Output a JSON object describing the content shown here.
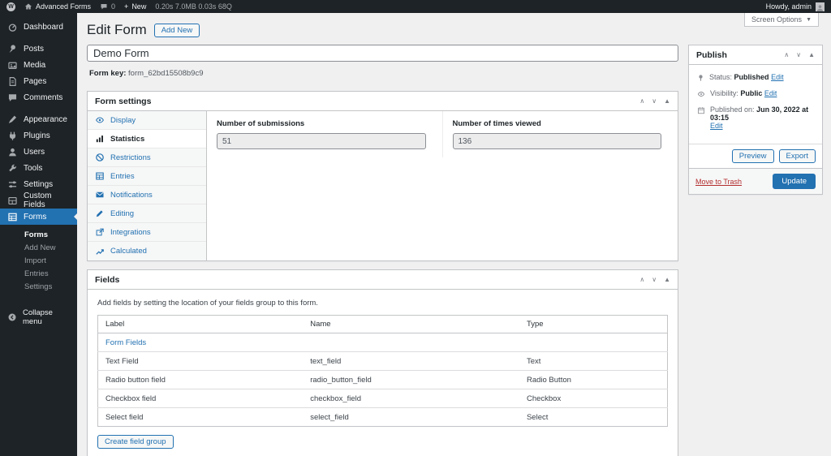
{
  "admin_bar": {
    "wp_logo_letter": "W",
    "site_name": "Advanced Forms",
    "comments_count": "0",
    "plus": "+",
    "new_label": "New",
    "perf_stats": "0.20s 7.0MB 0.03s 68Q",
    "howdy": "Howdy, admin"
  },
  "sidebar": {
    "items": [
      "Dashboard",
      "Posts",
      "Media",
      "Pages",
      "Comments",
      "Appearance",
      "Plugins",
      "Users",
      "Tools",
      "Settings",
      "Custom Fields",
      "Forms"
    ],
    "submenu": [
      "Forms",
      "Add New",
      "Import",
      "Entries",
      "Settings"
    ],
    "collapse_label": "Collapse menu"
  },
  "header": {
    "screen_options": "Screen Options",
    "title": "Edit Form",
    "add_new": "Add New"
  },
  "form": {
    "title_value": "Demo Form",
    "key_label": "Form key:",
    "key_value": "form_62bd15508b9c9"
  },
  "form_settings": {
    "title": "Form settings",
    "tabs": [
      "Display",
      "Statistics",
      "Restrictions",
      "Entries",
      "Notifications",
      "Editing",
      "Integrations",
      "Calculated"
    ],
    "active_tab": "Statistics",
    "fields": [
      {
        "label": "Number of submissions",
        "value": "51"
      },
      {
        "label": "Number of times viewed",
        "value": "136"
      }
    ]
  },
  "fields_box": {
    "title": "Fields",
    "description": "Add fields by setting the location of your fields group to this form.",
    "headers": [
      "Label",
      "Name",
      "Type"
    ],
    "group_label": "Form Fields",
    "rows": [
      [
        "Text Field",
        "text_field",
        "Text"
      ],
      [
        "Radio button field",
        "radio_button_field",
        "Radio Button"
      ],
      [
        "Checkbox field",
        "checkbox_field",
        "Checkbox"
      ],
      [
        "Select field",
        "select_field",
        "Select"
      ]
    ],
    "create_button": "Create field group"
  },
  "publish": {
    "title": "Publish",
    "status_label": "Status:",
    "status_value": "Published",
    "visibility_label": "Visibility:",
    "visibility_value": "Public",
    "published_label": "Published on:",
    "published_value": "Jun 30, 2022 at 03:15",
    "edit_link": "Edit",
    "preview": "Preview",
    "export": "Export",
    "trash": "Move to Trash",
    "update": "Update"
  },
  "icons": {
    "up": "∧",
    "down": "∨",
    "toggle_open": "▲",
    "dropdown": "▼"
  },
  "colors": {
    "accent": "#2271b1",
    "dark": "#1d2327",
    "page_bg": "#f0f0f1",
    "border": "#c3c4c7",
    "danger": "#b32d2e"
  }
}
